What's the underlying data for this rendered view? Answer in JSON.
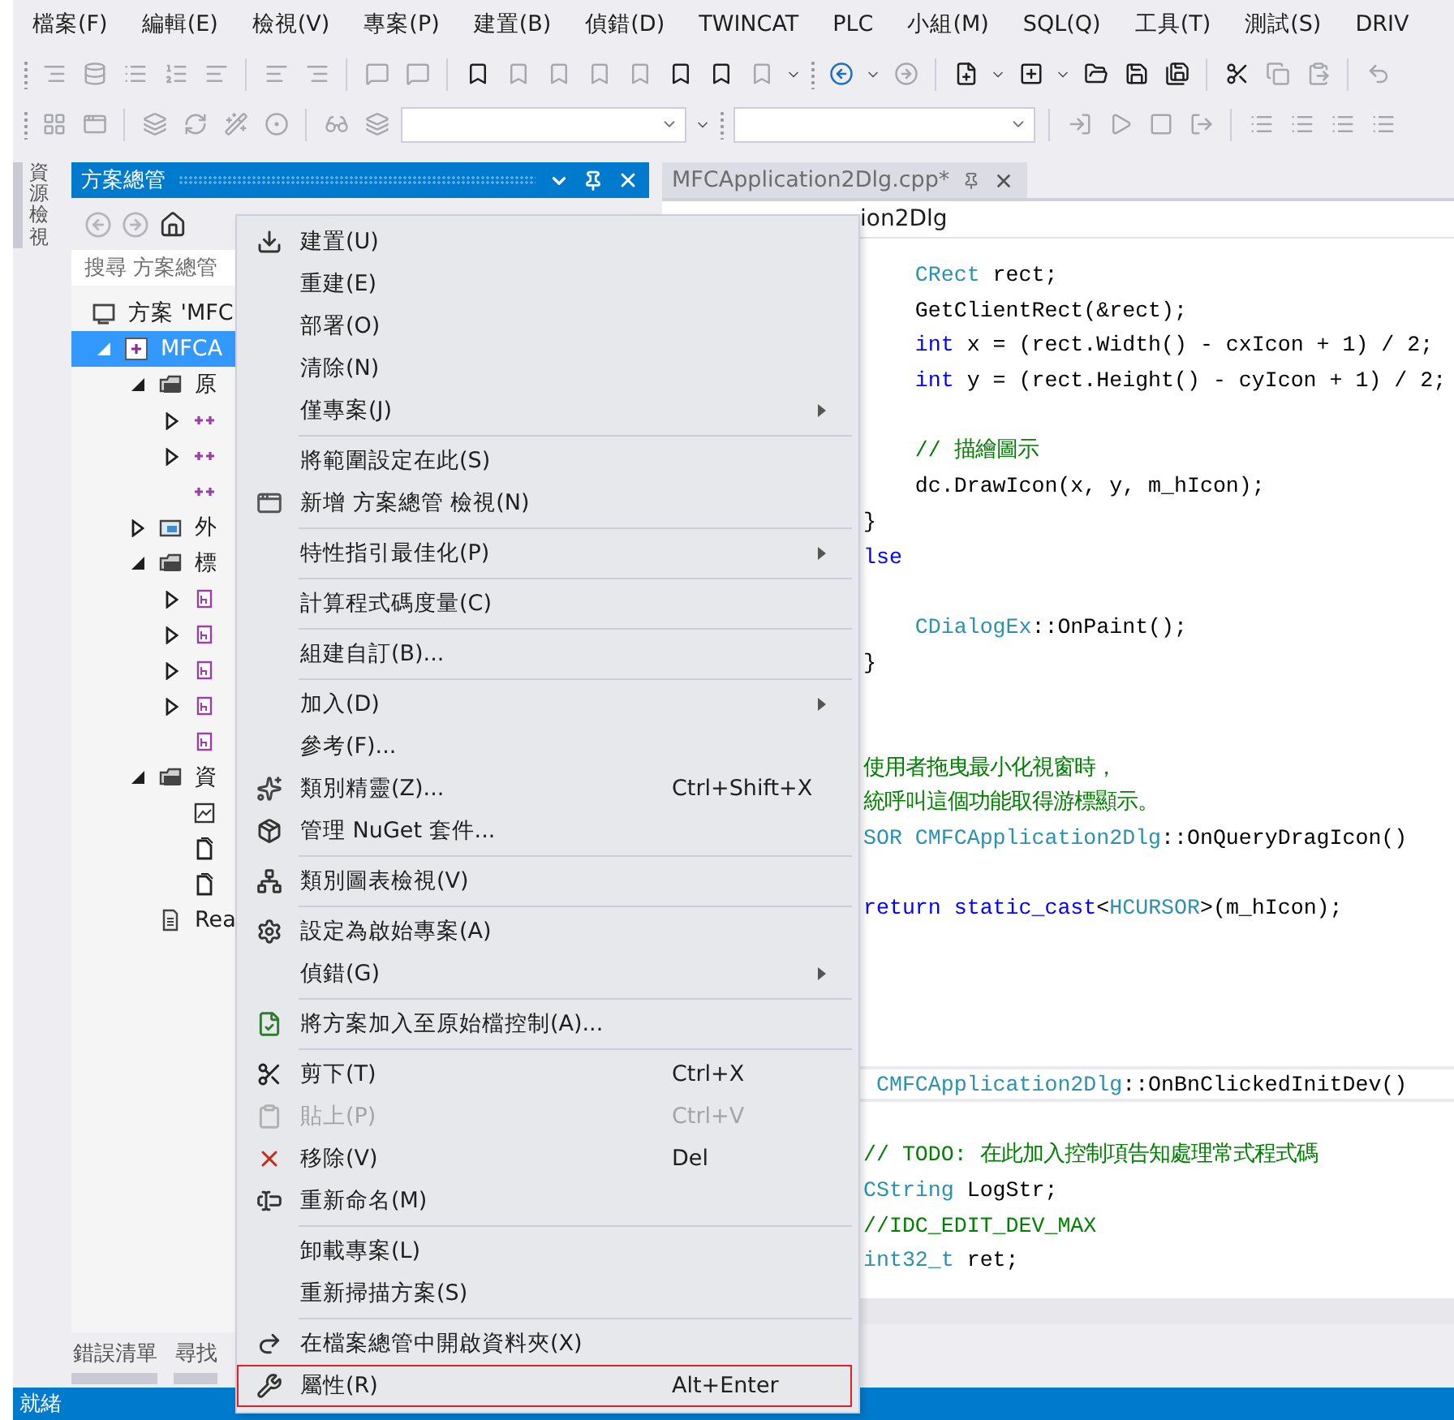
{
  "menubar": [
    {
      "label": "檔案(F)"
    },
    {
      "label": "編輯(E)"
    },
    {
      "label": "檢視(V)"
    },
    {
      "label": "專案(P)"
    },
    {
      "label": "建置(B)"
    },
    {
      "label": "偵錯(D)"
    },
    {
      "label": "TWINCAT"
    },
    {
      "label": "PLC"
    },
    {
      "label": "小組(M)"
    },
    {
      "label": "SQL(Q)"
    },
    {
      "label": "工具(T)"
    },
    {
      "label": "測試(S)"
    },
    {
      "label": "DRIV"
    }
  ],
  "side_tabs": [
    {
      "label": "資源檢視"
    }
  ],
  "solution_explorer": {
    "title": "方案總管",
    "search": {
      "placeholder": "搜尋 方案總管"
    },
    "tree": [
      {
        "kind": "solution",
        "label": "方案 'MFC",
        "selected": false
      },
      {
        "kind": "project",
        "label": "MFCA",
        "selected": true,
        "expanded": true,
        "children": [
          {
            "kind": "filter",
            "label": "原",
            "selected": false,
            "expanded": true,
            "children": [
              {
                "kind": "source",
                "selected": false,
                "expanded": false
              },
              {
                "kind": "source",
                "selected": false,
                "expanded": false
              },
              {
                "kind": "source",
                "selected": false
              }
            ]
          },
          {
            "kind": "external",
            "label": "外",
            "selected": false,
            "expanded": false
          },
          {
            "kind": "filter",
            "label": "標",
            "selected": false,
            "expanded": true,
            "children": [
              {
                "kind": "header",
                "selected": false,
                "expanded": false
              },
              {
                "kind": "header",
                "selected": false,
                "expanded": false
              },
              {
                "kind": "header",
                "selected": false,
                "expanded": false
              },
              {
                "kind": "header",
                "selected": false,
                "expanded": false
              },
              {
                "kind": "header",
                "selected": false
              }
            ]
          },
          {
            "kind": "filter",
            "label": "資",
            "selected": false,
            "expanded": true,
            "children": [
              {
                "kind": "resource",
                "selected": false
              },
              {
                "kind": "file",
                "selected": false
              },
              {
                "kind": "file",
                "selected": false
              }
            ]
          },
          {
            "kind": "text",
            "label": "Rea",
            "selected": false
          }
        ]
      }
    ],
    "bottom_tabs": [
      {
        "label": "錯誤清單",
        "selected": false
      },
      {
        "label": "尋找",
        "selected": false
      }
    ]
  },
  "editor": {
    "tabs": [
      {
        "label": "MFCApplication2Dlg.cpp*",
        "selected": false
      }
    ],
    "navigation": "ion2Dlg",
    "lines": [
      {
        "current": false,
        "segments": [
          {
            "text": "    CRect",
            "kind": "type"
          },
          {
            "text": " rect;",
            "kind": "plain"
          }
        ]
      },
      {
        "current": false,
        "segments": [
          {
            "text": "    GetClientRect(&rect);",
            "kind": "plain"
          }
        ]
      },
      {
        "current": false,
        "segments": [
          {
            "text": "    int",
            "kind": "keyword"
          },
          {
            "text": " x = (rect.Width() - cxIcon + 1) / 2;",
            "kind": "plain"
          }
        ]
      },
      {
        "current": false,
        "segments": [
          {
            "text": "    int",
            "kind": "keyword"
          },
          {
            "text": " y = (rect.Height() - cyIcon + 1) / 2;",
            "kind": "plain"
          }
        ]
      },
      {
        "current": false
      },
      {
        "current": false,
        "segments": [
          {
            "text": "    // 描繪圖示",
            "kind": "comment"
          }
        ]
      },
      {
        "current": false,
        "segments": [
          {
            "text": "    dc.DrawIcon(x, y, m_hIcon);",
            "kind": "plain"
          }
        ]
      },
      {
        "current": false,
        "segments": [
          {
            "text": "}",
            "kind": "plain"
          }
        ]
      },
      {
        "current": false,
        "segments": [
          {
            "text": "lse",
            "kind": "keyword"
          }
        ]
      },
      {
        "current": false
      },
      {
        "current": false,
        "segments": [
          {
            "text": "    CDialogEx",
            "kind": "type"
          },
          {
            "text": "::OnPaint();",
            "kind": "plain"
          }
        ]
      },
      {
        "current": false,
        "segments": [
          {
            "text": "}",
            "kind": "plain"
          }
        ]
      },
      {
        "current": false
      },
      {
        "current": false
      },
      {
        "current": false,
        "segments": [
          {
            "text": "使用者拖曳最小化視窗時，",
            "kind": "comment"
          }
        ]
      },
      {
        "current": false,
        "segments": [
          {
            "text": "統呼叫這個功能取得游標顯示。",
            "kind": "comment"
          }
        ]
      },
      {
        "current": false,
        "segments": [
          {
            "text": "SOR CMFCApplication2Dlg",
            "kind": "type"
          },
          {
            "text": "::OnQueryDragIcon()",
            "kind": "plain"
          }
        ]
      },
      {
        "current": false
      },
      {
        "current": false,
        "segments": [
          {
            "text": "return static_cast",
            "kind": "keyword"
          },
          {
            "text": "<",
            "kind": "plain"
          },
          {
            "text": "HCURSOR",
            "kind": "type"
          },
          {
            "text": ">(m_hIcon);",
            "kind": "plain"
          }
        ]
      },
      {
        "current": false
      },
      {
        "current": false
      },
      {
        "current": false
      },
      {
        "current": false
      },
      {
        "current": true,
        "segments": [
          {
            "text": " CMFCApplication2Dlg",
            "kind": "type"
          },
          {
            "text": "::OnBnClickedInitDev()",
            "kind": "plain"
          }
        ]
      },
      {
        "current": false
      },
      {
        "current": false,
        "segments": [
          {
            "text": "// TODO: 在此加入控制項告知處理常式程式碼",
            "kind": "comment"
          }
        ]
      },
      {
        "current": false,
        "segments": [
          {
            "text": "CString",
            "kind": "type"
          },
          {
            "text": " LogStr;",
            "kind": "plain"
          }
        ]
      },
      {
        "current": false,
        "segments": [
          {
            "text": "//IDC_EDIT_DEV_MAX",
            "kind": "comment"
          }
        ]
      },
      {
        "current": false,
        "segments": [
          {
            "text": "int32_t",
            "kind": "type"
          },
          {
            "text": " ret;",
            "kind": "plain"
          }
        ]
      }
    ]
  },
  "context_menu": [
    {
      "kind": "item",
      "label": "建置(U)",
      "submenu": false,
      "disabled": false,
      "outlined": false
    },
    {
      "kind": "item",
      "label": "重建(E)",
      "submenu": false,
      "disabled": false,
      "outlined": false
    },
    {
      "kind": "item",
      "label": "部署(O)",
      "submenu": false,
      "disabled": false,
      "outlined": false
    },
    {
      "kind": "item",
      "label": "清除(N)",
      "submenu": false,
      "disabled": false,
      "outlined": false
    },
    {
      "kind": "item",
      "label": "僅專案(J)",
      "submenu": true,
      "disabled": false,
      "outlined": false
    },
    {
      "kind": "separator"
    },
    {
      "kind": "item",
      "label": "將範圍設定在此(S)",
      "submenu": false,
      "disabled": false,
      "outlined": false
    },
    {
      "kind": "item",
      "label": "新增 方案總管 檢視(N)",
      "submenu": false,
      "disabled": false,
      "outlined": false
    },
    {
      "kind": "separator"
    },
    {
      "kind": "item",
      "label": "特性指引最佳化(P)",
      "submenu": true,
      "disabled": false,
      "outlined": false
    },
    {
      "kind": "separator"
    },
    {
      "kind": "item",
      "label": "計算程式碼度量(C)",
      "submenu": false,
      "disabled": false,
      "outlined": false
    },
    {
      "kind": "separator"
    },
    {
      "kind": "item",
      "label": "組建自訂(B)...",
      "submenu": false,
      "disabled": false,
      "outlined": false
    },
    {
      "kind": "separator"
    },
    {
      "kind": "item",
      "label": "加入(D)",
      "submenu": true,
      "disabled": false,
      "outlined": false
    },
    {
      "kind": "item",
      "label": "參考(F)...",
      "submenu": false,
      "disabled": false,
      "outlined": false
    },
    {
      "kind": "item",
      "label": "類別精靈(Z)...",
      "shortcut": "Ctrl+Shift+X",
      "submenu": false,
      "disabled": false,
      "outlined": false
    },
    {
      "kind": "item",
      "label": "管理 NuGet 套件...",
      "submenu": false,
      "disabled": false,
      "outlined": false
    },
    {
      "kind": "separator"
    },
    {
      "kind": "item",
      "label": "類別圖表檢視(V)",
      "submenu": false,
      "disabled": false,
      "outlined": false
    },
    {
      "kind": "separator"
    },
    {
      "kind": "item",
      "label": "設定為啟始專案(A)",
      "submenu": false,
      "disabled": false,
      "outlined": false
    },
    {
      "kind": "item",
      "label": "偵錯(G)",
      "submenu": true,
      "disabled": false,
      "outlined": false
    },
    {
      "kind": "separator"
    },
    {
      "kind": "item",
      "label": "將方案加入至原始檔控制(A)...",
      "submenu": false,
      "disabled": false,
      "outlined": false
    },
    {
      "kind": "separator"
    },
    {
      "kind": "item",
      "label": "剪下(T)",
      "shortcut": "Ctrl+X",
      "submenu": false,
      "disabled": false,
      "outlined": false
    },
    {
      "kind": "item",
      "label": "貼上(P)",
      "shortcut": "Ctrl+V",
      "submenu": false,
      "disabled": true,
      "outlined": false
    },
    {
      "kind": "item",
      "label": "移除(V)",
      "shortcut": "Del",
      "submenu": false,
      "disabled": false,
      "outlined": false
    },
    {
      "kind": "item",
      "label": "重新命名(M)",
      "submenu": false,
      "disabled": false,
      "outlined": false
    },
    {
      "kind": "separator"
    },
    {
      "kind": "item",
      "label": "卸載專案(L)",
      "submenu": false,
      "disabled": false,
      "outlined": false
    },
    {
      "kind": "item",
      "label": "重新掃描方案(S)",
      "submenu": false,
      "disabled": false,
      "outlined": false
    },
    {
      "kind": "separator"
    },
    {
      "kind": "item",
      "label": "在檔案總管中開啟資料夾(X)",
      "submenu": false,
      "disabled": false,
      "outlined": false
    },
    {
      "kind": "item",
      "label": "屬性(R)",
      "shortcut": "Alt+Enter",
      "submenu": false,
      "disabled": false,
      "outlined": true
    }
  ],
  "status_bar": {
    "text": "就緒"
  }
}
